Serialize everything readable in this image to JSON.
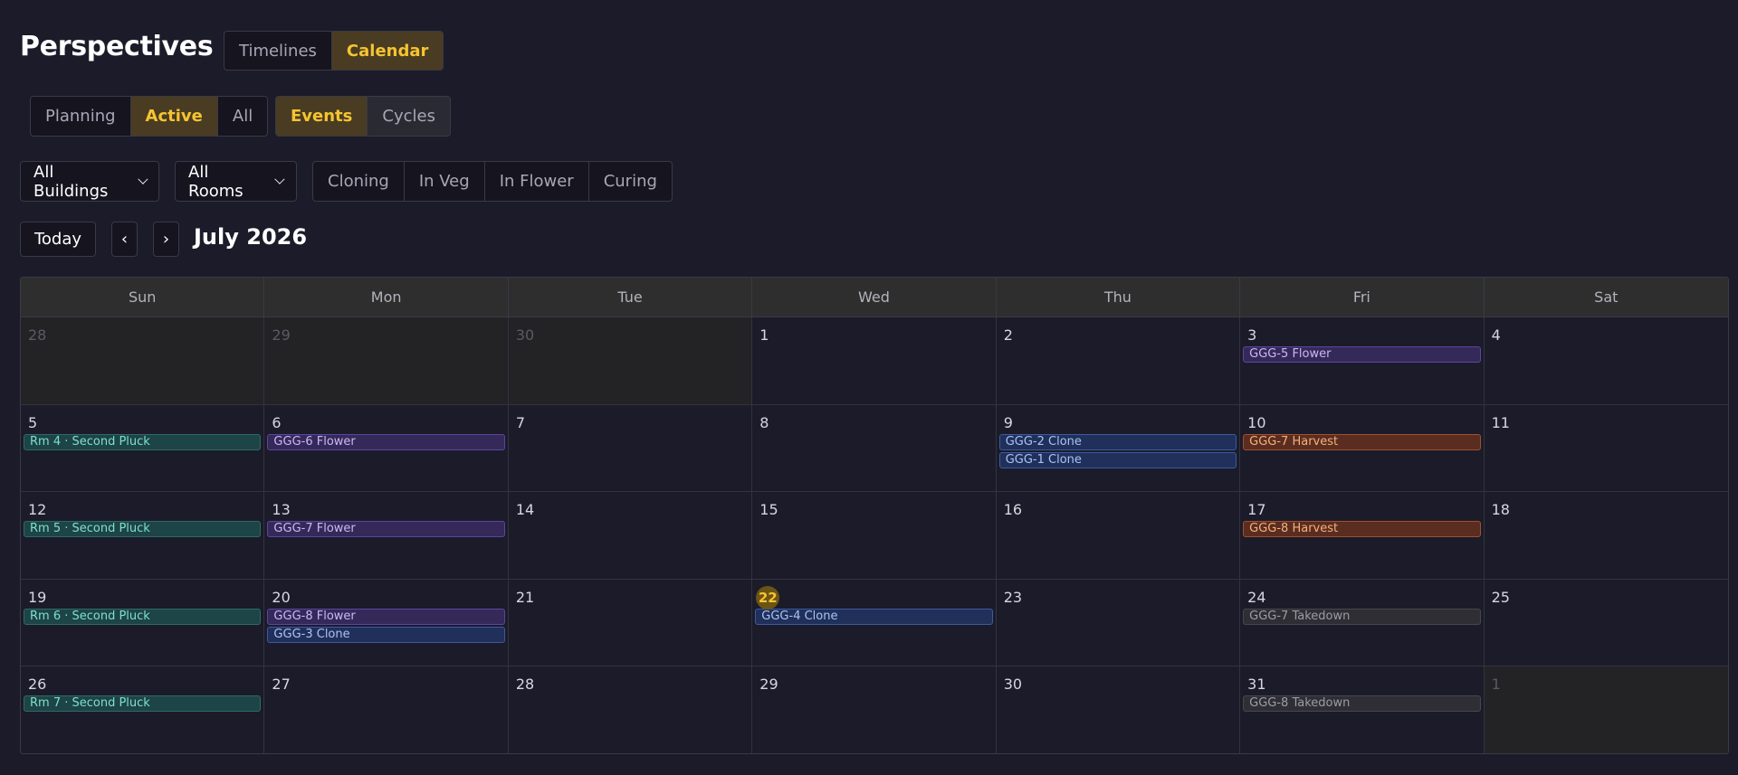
{
  "page_title": "Perspectives",
  "view_toggle": [
    {
      "label": "Timelines",
      "active": false
    },
    {
      "label": "Calendar",
      "active": true
    }
  ],
  "scope_toggle": [
    {
      "label": "Planning",
      "active": false
    },
    {
      "label": "Active",
      "active": true
    },
    {
      "label": "All",
      "active": false
    }
  ],
  "type_toggle": [
    {
      "label": "Events",
      "active": true
    },
    {
      "label": "Cycles",
      "active": false
    }
  ],
  "filters": {
    "buildings": "All Buildings",
    "rooms": "All Rooms",
    "stages": [
      "Cloning",
      "In Veg",
      "In Flower",
      "Curing"
    ]
  },
  "nav": {
    "today_label": "Today",
    "prev_label": "‹",
    "next_label": "›",
    "month_label": "July 2026"
  },
  "weekdays": [
    "Sun",
    "Mon",
    "Tue",
    "Wed",
    "Thu",
    "Fri",
    "Sat"
  ],
  "colors": {
    "accent": "#f5c431",
    "flower": "#5a46a0",
    "clone": "#3c5aa0",
    "pluck": "#2e6a66",
    "harvest": "#a0502f",
    "takedown": "#47464f"
  },
  "days": [
    {
      "n": "28",
      "out": true,
      "events": []
    },
    {
      "n": "29",
      "out": true,
      "events": []
    },
    {
      "n": "30",
      "out": true,
      "events": []
    },
    {
      "n": "1",
      "events": []
    },
    {
      "n": "2",
      "events": []
    },
    {
      "n": "3",
      "events": [
        {
          "label": "GGG-5 Flower",
          "kind": "flower"
        }
      ]
    },
    {
      "n": "4",
      "events": []
    },
    {
      "n": "5",
      "events": [
        {
          "label": "Rm 4 · Second Pluck",
          "kind": "pluck"
        }
      ]
    },
    {
      "n": "6",
      "events": [
        {
          "label": "GGG-6 Flower",
          "kind": "flower"
        }
      ]
    },
    {
      "n": "7",
      "events": []
    },
    {
      "n": "8",
      "events": []
    },
    {
      "n": "9",
      "events": [
        {
          "label": "GGG-2 Clone",
          "kind": "clone"
        },
        {
          "label": "GGG-1 Clone",
          "kind": "clone"
        }
      ]
    },
    {
      "n": "10",
      "events": [
        {
          "label": "GGG-7 Harvest",
          "kind": "harvest"
        }
      ]
    },
    {
      "n": "11",
      "events": []
    },
    {
      "n": "12",
      "events": [
        {
          "label": "Rm 5 · Second Pluck",
          "kind": "pluck"
        }
      ]
    },
    {
      "n": "13",
      "events": [
        {
          "label": "GGG-7 Flower",
          "kind": "flower"
        }
      ]
    },
    {
      "n": "14",
      "events": []
    },
    {
      "n": "15",
      "events": []
    },
    {
      "n": "16",
      "events": []
    },
    {
      "n": "17",
      "events": [
        {
          "label": "GGG-8 Harvest",
          "kind": "harvest"
        }
      ]
    },
    {
      "n": "18",
      "events": []
    },
    {
      "n": "19",
      "events": [
        {
          "label": "Rm 6 · Second Pluck",
          "kind": "pluck"
        }
      ]
    },
    {
      "n": "20",
      "events": [
        {
          "label": "GGG-8 Flower",
          "kind": "flower"
        },
        {
          "label": "GGG-3 Clone",
          "kind": "clone"
        }
      ]
    },
    {
      "n": "21",
      "events": []
    },
    {
      "n": "22",
      "today": true,
      "events": [
        {
          "label": "GGG-4 Clone",
          "kind": "clone"
        }
      ]
    },
    {
      "n": "23",
      "events": []
    },
    {
      "n": "24",
      "events": [
        {
          "label": "GGG-7 Takedown",
          "kind": "takedown"
        }
      ]
    },
    {
      "n": "25",
      "events": []
    },
    {
      "n": "26",
      "events": [
        {
          "label": "Rm 7 · Second Pluck",
          "kind": "pluck"
        }
      ]
    },
    {
      "n": "27",
      "events": []
    },
    {
      "n": "28",
      "events": []
    },
    {
      "n": "29",
      "events": []
    },
    {
      "n": "30",
      "events": []
    },
    {
      "n": "31",
      "events": [
        {
          "label": "GGG-8 Takedown",
          "kind": "takedown"
        }
      ]
    },
    {
      "n": "1",
      "out": true,
      "events": []
    }
  ]
}
